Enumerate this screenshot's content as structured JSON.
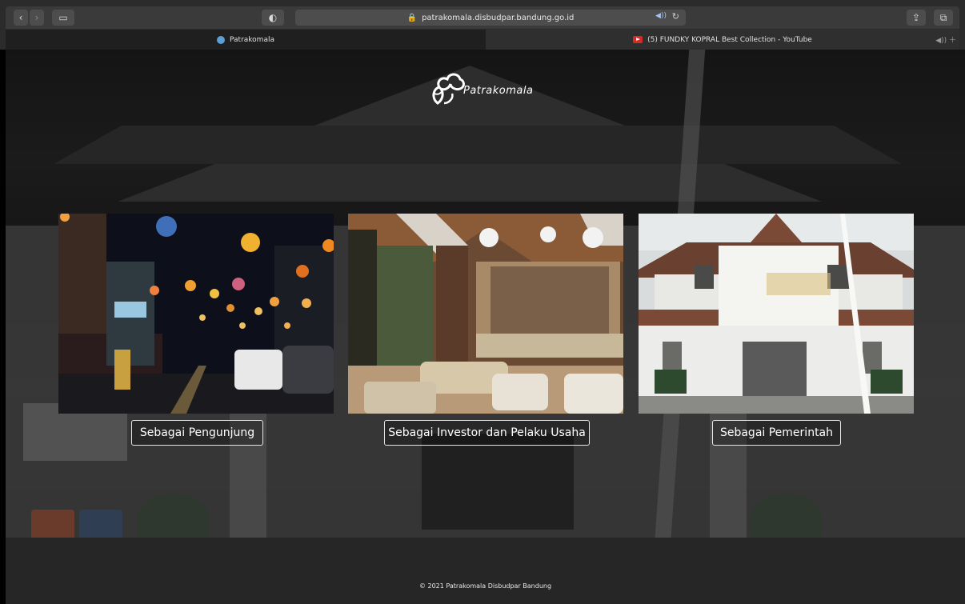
{
  "browser": {
    "url": "patrakomala.disbudpar.bandung.go.id",
    "tabs": [
      {
        "label": "Patrakomala",
        "active": true
      },
      {
        "label": "(5) FUNDKY KOPRAL Best Collection - YouTube",
        "active": false
      }
    ],
    "icons": [
      "back-icon",
      "forward-icon",
      "sidebar-icon",
      "shield-icon",
      "lock-icon",
      "audio-icon",
      "reload-icon",
      "share-icon",
      "tabs-icon"
    ]
  },
  "site": {
    "logo_text": "Patrakomala",
    "cards": [
      {
        "button": "Sebagai Pengunjung",
        "image": "night street market with lanterns"
      },
      {
        "button": "Sebagai Investor dan Pelaku Usaha",
        "image": "cafe interior"
      },
      {
        "button": "Sebagai Pemerintah",
        "image": "government office building"
      }
    ],
    "footer": "© 2021 Patrakomala Disbudpar Bandung"
  },
  "colors": {
    "chrome_bg": "#2b2b2b",
    "toolbar_bg": "#3a3a3a",
    "button_border": "#e6e6e6",
    "youtube_red": "#d52b24"
  }
}
